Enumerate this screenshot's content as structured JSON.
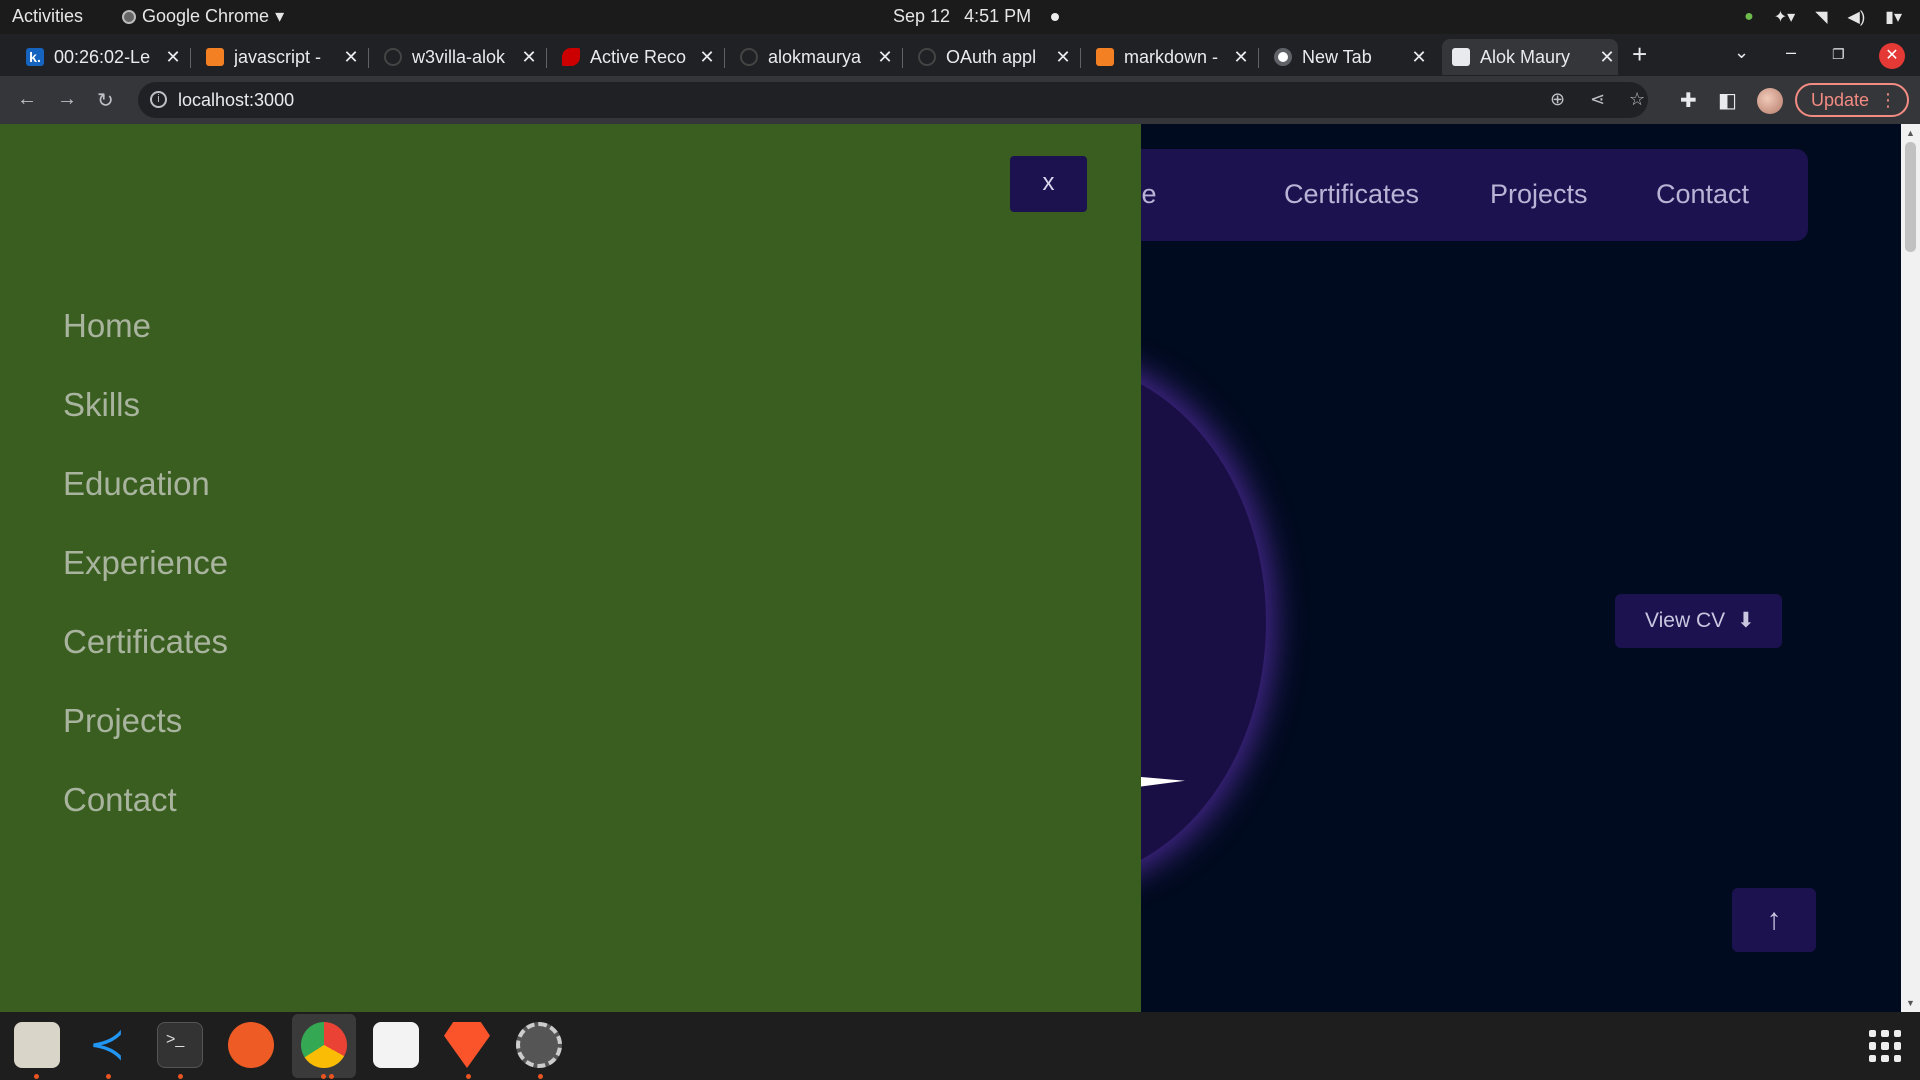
{
  "system_bar": {
    "activities": "Activities",
    "app_name": "Google Chrome",
    "date": "Sep 12",
    "time": "4:51 PM"
  },
  "tabs": [
    {
      "title": "00:26:02-Le",
      "icon": "k-icon"
    },
    {
      "title": "javascript - ",
      "icon": "stackoverflow-icon"
    },
    {
      "title": "w3villa-alok",
      "icon": "github-icon"
    },
    {
      "title": "Active Reco",
      "icon": "rails-icon"
    },
    {
      "title": "alokmaurya",
      "icon": "github-icon"
    },
    {
      "title": "OAuth appl",
      "icon": "github-icon"
    },
    {
      "title": "markdown -",
      "icon": "stackoverflow-icon"
    },
    {
      "title": "New Tab",
      "icon": "chrome-icon"
    },
    {
      "title": "Alok Maury",
      "icon": "page-icon",
      "active": true
    }
  ],
  "toolbar": {
    "url": "localhost:3000",
    "update_label": "Update"
  },
  "page": {
    "top_nav": [
      "erience",
      "Certificates",
      "Projects",
      "Contact"
    ],
    "view_cv_label": "View CV",
    "close_label": "x",
    "side_menu": [
      "Home",
      "Skills",
      "Education",
      "Experience",
      "Certificates",
      "Projects",
      "Contact"
    ]
  },
  "colors": {
    "side_menu_bg": "#3a5e20",
    "page_bg": "#010b1f",
    "nav_bg": "#1b124f",
    "planet_glow": "#7b3fe4"
  },
  "dock_apps": [
    "files-icon",
    "vscode-icon",
    "terminal-icon",
    "postman-icon",
    "chrome-icon",
    "archive-icon",
    "brave-icon",
    "settings-icon"
  ]
}
